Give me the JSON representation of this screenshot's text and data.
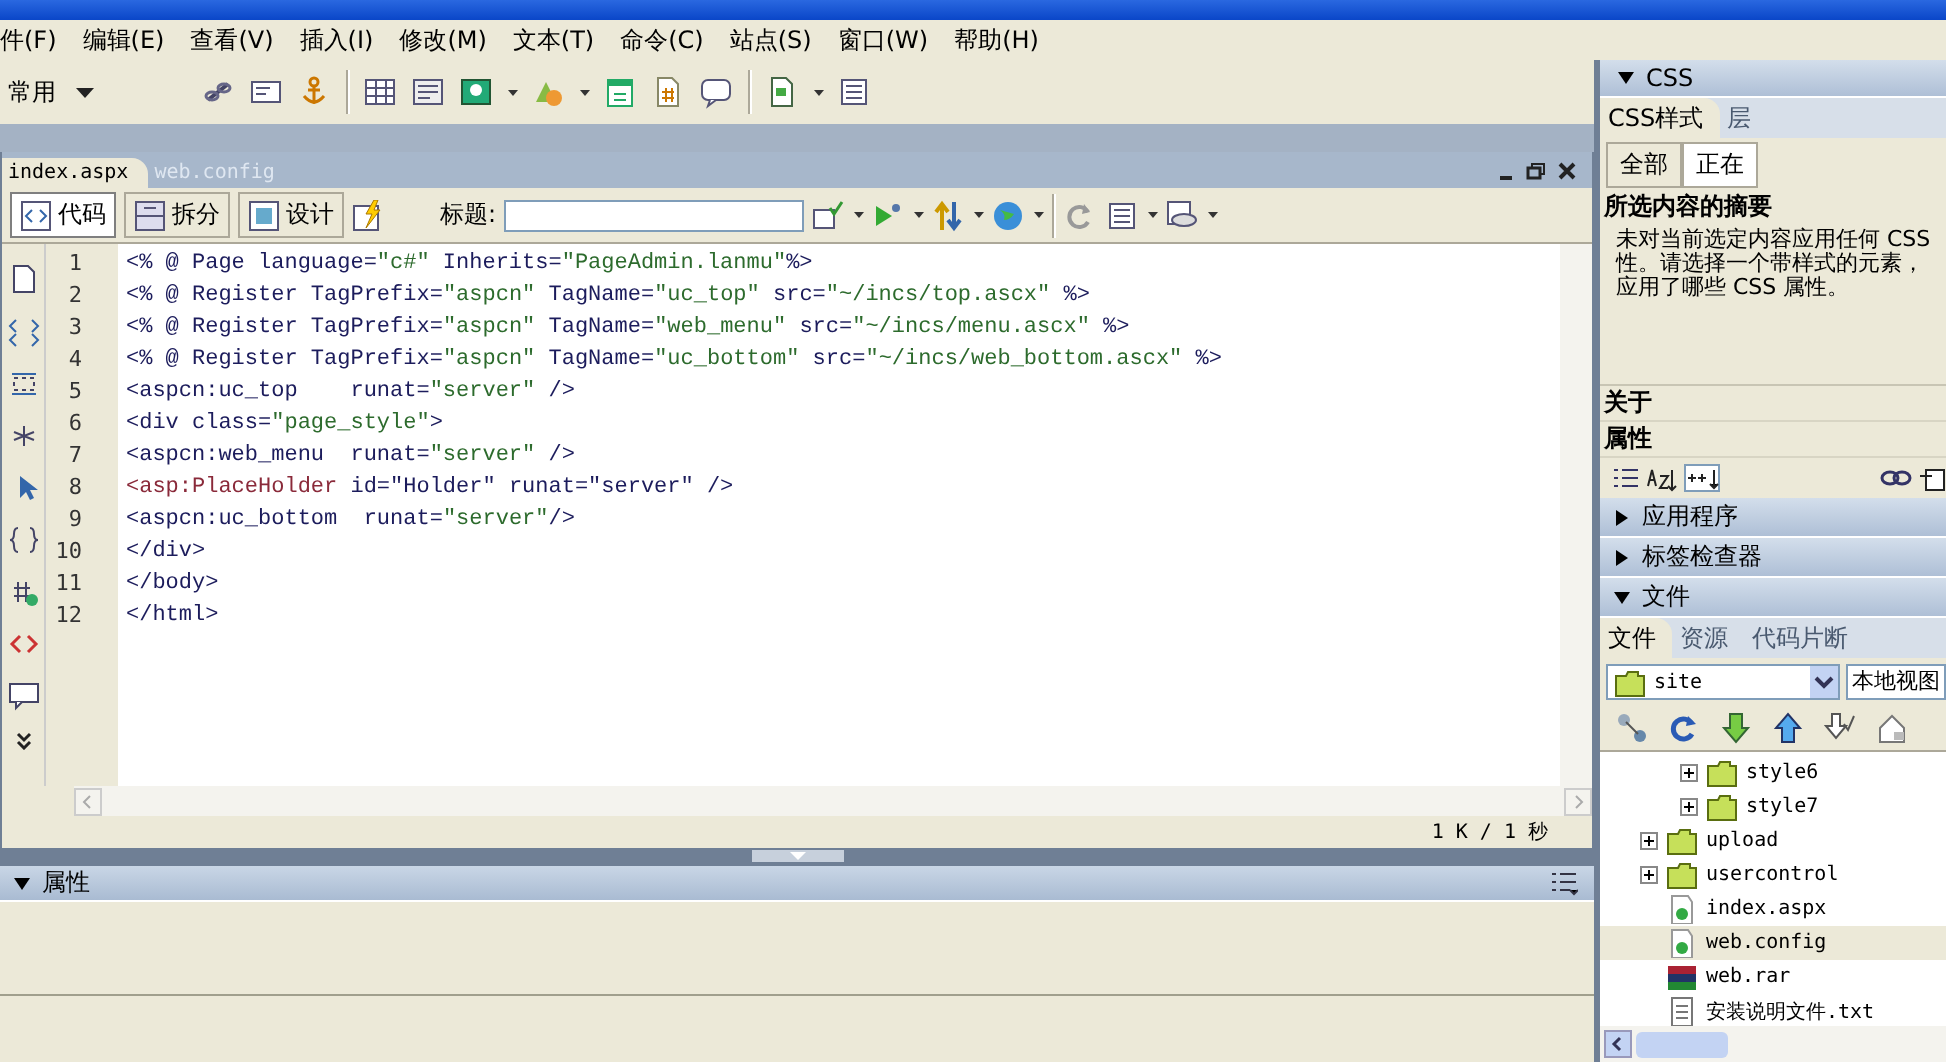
{
  "menu": [
    "件(F)",
    "编辑(E)",
    "查看(V)",
    "插入(I)",
    "修改(M)",
    "文本(T)",
    "命令(C)",
    "站点(S)",
    "窗口(W)",
    "帮助(H)"
  ],
  "insert_bar": {
    "category": "常用"
  },
  "document": {
    "tabs": [
      {
        "label": "index.aspx",
        "selected": true
      },
      {
        "label": "web.config",
        "selected": false
      }
    ],
    "view_buttons": [
      {
        "label": "代码",
        "selected": true
      },
      {
        "label": "拆分",
        "selected": false
      },
      {
        "label": "设计",
        "selected": false
      }
    ],
    "title_label": "标题:",
    "code_lines": [
      {
        "number": "1",
        "segments": [
          {
            "text": "<% @ Page language=",
            "kind": "code"
          },
          {
            "text": "\"c#\"",
            "kind": "string"
          },
          {
            "text": " Inherits=",
            "kind": "code"
          },
          {
            "text": "\"PageAdmin.lanmu\"",
            "kind": "string"
          },
          {
            "text": "%>",
            "kind": "code"
          }
        ]
      },
      {
        "number": "2",
        "segments": [
          {
            "text": "<% @ Register TagPrefix=",
            "kind": "code"
          },
          {
            "text": "\"aspcn\"",
            "kind": "string"
          },
          {
            "text": " TagName=",
            "kind": "code"
          },
          {
            "text": "\"uc_top\"",
            "kind": "string"
          },
          {
            "text": " src=",
            "kind": "code"
          },
          {
            "text": "\"~/incs/top.ascx\"",
            "kind": "string"
          },
          {
            "text": " %>",
            "kind": "code"
          }
        ]
      },
      {
        "number": "3",
        "segments": [
          {
            "text": "<% @ Register TagPrefix=",
            "kind": "code"
          },
          {
            "text": "\"aspcn\"",
            "kind": "string"
          },
          {
            "text": " TagName=",
            "kind": "code"
          },
          {
            "text": "\"web_menu\"",
            "kind": "string"
          },
          {
            "text": " src=",
            "kind": "code"
          },
          {
            "text": "\"~/incs/menu.ascx\"",
            "kind": "string"
          },
          {
            "text": " %>",
            "kind": "code"
          }
        ]
      },
      {
        "number": "4",
        "segments": [
          {
            "text": "<% @ Register TagPrefix=",
            "kind": "code"
          },
          {
            "text": "\"aspcn\"",
            "kind": "string"
          },
          {
            "text": " TagName=",
            "kind": "code"
          },
          {
            "text": "\"uc_bottom\"",
            "kind": "string"
          },
          {
            "text": " src=",
            "kind": "code"
          },
          {
            "text": "\"~/incs/web_bottom.ascx\"",
            "kind": "string"
          },
          {
            "text": " %>",
            "kind": "code"
          }
        ]
      },
      {
        "number": "5",
        "segments": [
          {
            "text": "<aspcn:uc_top    runat=",
            "kind": "code"
          },
          {
            "text": "\"server\"",
            "kind": "string"
          },
          {
            "text": " />",
            "kind": "code"
          }
        ]
      },
      {
        "number": "6",
        "segments": [
          {
            "text": "<div class=",
            "kind": "code"
          },
          {
            "text": "\"page_style\"",
            "kind": "string"
          },
          {
            "text": ">",
            "kind": "code"
          }
        ]
      },
      {
        "number": "7",
        "segments": [
          {
            "text": "<aspcn:web_menu  runat=",
            "kind": "code"
          },
          {
            "text": "\"server\"",
            "kind": "string"
          },
          {
            "text": " />",
            "kind": "code"
          }
        ]
      },
      {
        "number": "8",
        "segments": [
          {
            "text": "<asp:PlaceHolder",
            "kind": "server"
          },
          {
            "text": " id=\"Holder\" runat=\"server\" />",
            "kind": "code"
          }
        ]
      },
      {
        "number": "9",
        "segments": [
          {
            "text": "<aspcn:uc_bottom  runat=",
            "kind": "code"
          },
          {
            "text": "\"server\"",
            "kind": "string"
          },
          {
            "text": "/>",
            "kind": "code"
          }
        ]
      },
      {
        "number": "10",
        "segments": [
          {
            "text": "</div>",
            "kind": "code"
          }
        ]
      },
      {
        "number": "11",
        "segments": [
          {
            "text": "</body>",
            "kind": "code"
          }
        ]
      },
      {
        "number": "12",
        "segments": [
          {
            "text": "</html>",
            "kind": "code"
          }
        ]
      }
    ],
    "status": "1 K / 1 秒"
  },
  "properties_panel": {
    "title": "属性",
    "expanded": true
  },
  "side_panel": {
    "css": {
      "title": "CSS",
      "expanded": true,
      "tabs": [
        {
          "label": "CSS样式",
          "selected": true
        },
        {
          "label": "层",
          "selected": false
        }
      ],
      "modes": [
        {
          "label": "全部",
          "selected": false
        },
        {
          "label": "正在",
          "selected": true
        }
      ],
      "summary_title": "所选内容的摘要",
      "summary_lines": [
        "未对当前选定内容应用任何 CSS",
        "性。请选择一个带样式的元素，",
        "应用了哪些 CSS 属性。"
      ],
      "about": "关于",
      "properties": "属性"
    },
    "collapsed_panels": [
      {
        "title": "应用程序",
        "expanded": false
      },
      {
        "title": "标签检查器",
        "expanded": false
      }
    ],
    "files": {
      "title": "文件",
      "expanded": true,
      "tabs": [
        {
          "label": "文件",
          "selected": true
        },
        {
          "label": "资源",
          "selected": false
        },
        {
          "label": "代码片断",
          "selected": false
        }
      ],
      "site": "site",
      "view": "本地视图",
      "tree": [
        {
          "children": [
            {
              "label": "style6",
              "kind": "folder",
              "expandable": true,
              "selected": false
            },
            {
              "label": "style7",
              "kind": "folder",
              "expandable": true,
              "selected": false
            }
          ]
        },
        {
          "label": "upload",
          "kind": "folder",
          "expandable": true,
          "selected": false
        },
        {
          "label": "usercontrol",
          "kind": "folder",
          "expandable": true,
          "selected": false
        },
        {
          "label": "index.aspx",
          "kind": "page",
          "expandable": false,
          "selected": false
        },
        {
          "label": "web.config",
          "kind": "page",
          "expandable": false,
          "selected": true
        },
        {
          "label": "web.rar",
          "kind": "archive",
          "expandable": false,
          "selected": false
        },
        {
          "label": "安装说明文件.txt",
          "kind": "text",
          "expandable": false,
          "selected": false
        }
      ]
    }
  }
}
